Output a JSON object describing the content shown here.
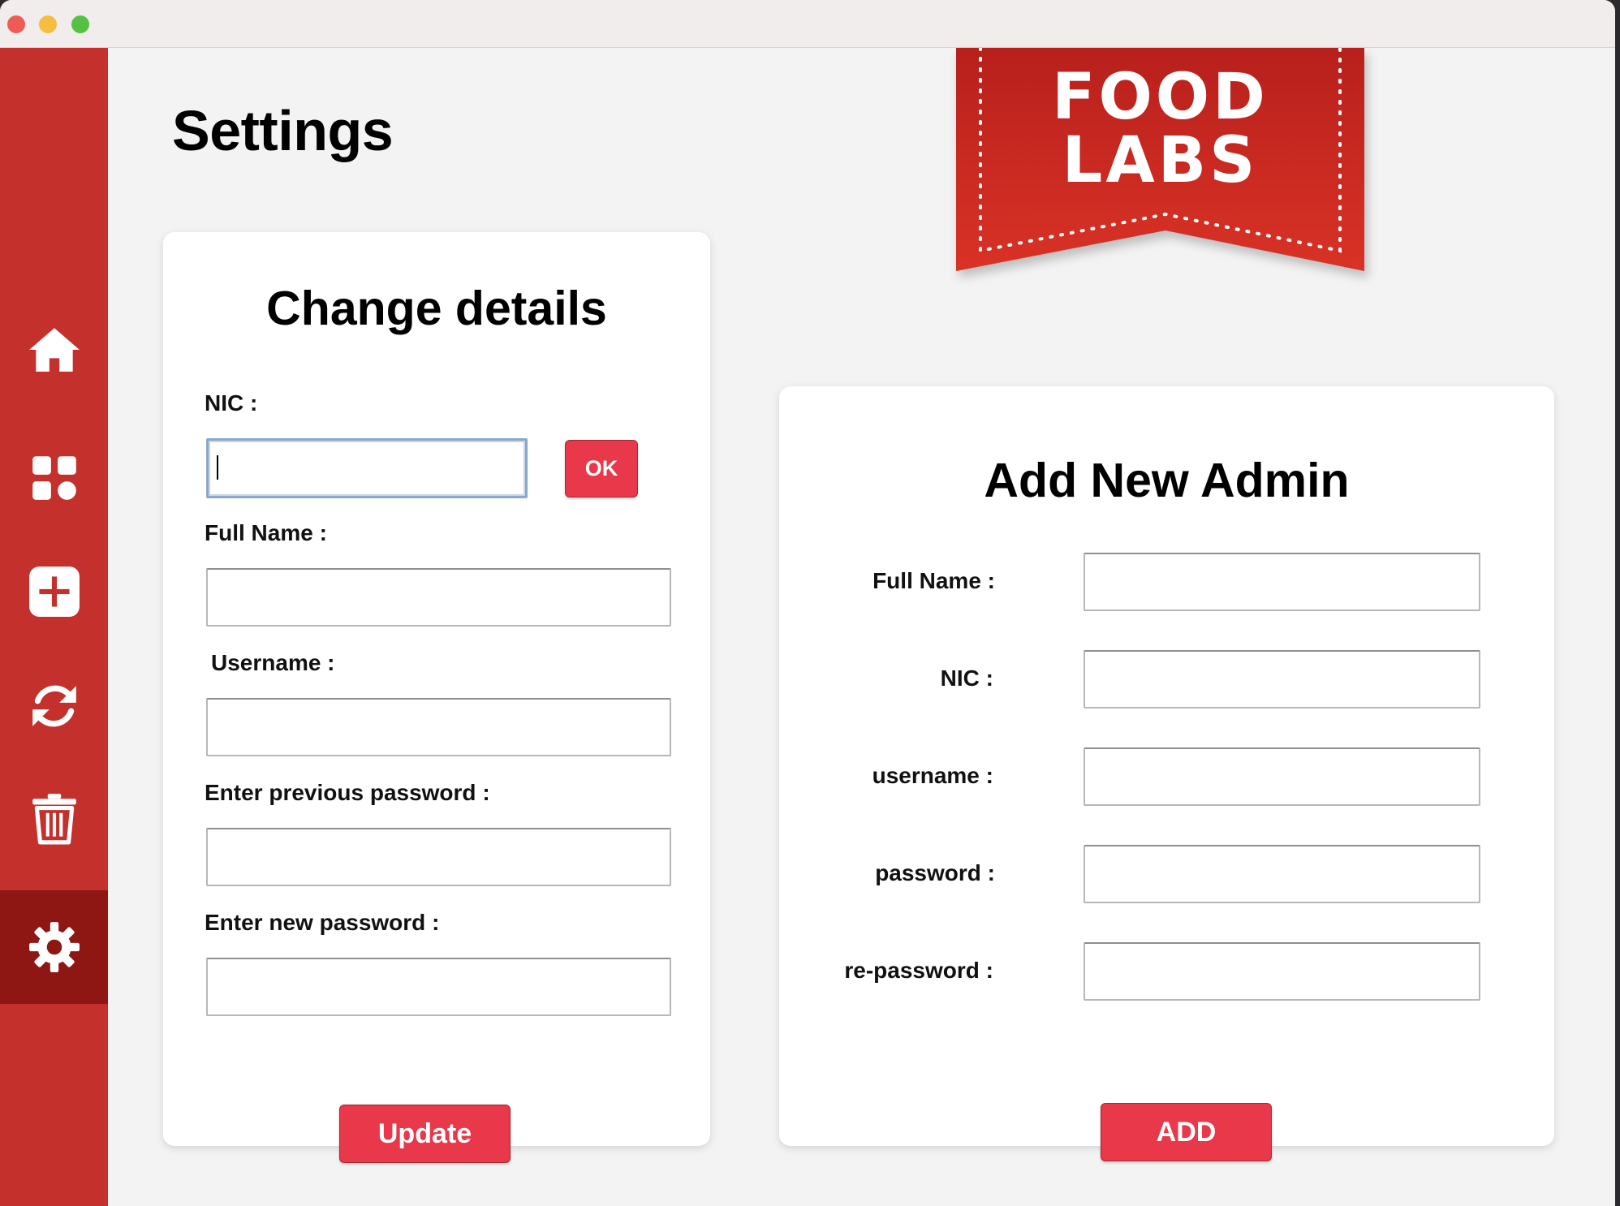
{
  "app": {
    "colors": {
      "sidebar": "#c4302b",
      "sidebar_active": "#8f1713",
      "accent": "#e8384a",
      "background": "#f3f3f3",
      "logo": "#c9302a"
    }
  },
  "sidebar": {
    "items": [
      {
        "icon": "home-icon",
        "active": false
      },
      {
        "icon": "dashboard-icon",
        "active": false
      },
      {
        "icon": "add-icon",
        "active": false
      },
      {
        "icon": "refresh-icon",
        "active": false
      },
      {
        "icon": "trash-icon",
        "active": false
      },
      {
        "icon": "gear-icon",
        "active": true
      }
    ]
  },
  "page": {
    "title": "Settings"
  },
  "logo": {
    "line1": "FOOD",
    "line2": "LABS"
  },
  "change_details": {
    "title": "Change details",
    "nic_label": "NIC :",
    "nic_value": "",
    "ok_label": "OK",
    "full_name_label": "Full Name :",
    "full_name_value": "",
    "username_label": "Username :",
    "username_value": "",
    "prev_password_label": "Enter previous password :",
    "prev_password_value": "",
    "new_password_label": "Enter new password :",
    "new_password_value": "",
    "update_label": "Update"
  },
  "add_admin": {
    "title": "Add New Admin",
    "full_name_label": "Full Name :",
    "full_name_value": "",
    "nic_label": "NIC :",
    "nic_value": "",
    "username_label": "username :",
    "username_value": "",
    "password_label": "password :",
    "password_value": "",
    "repassword_label": "re-password :",
    "repassword_value": "",
    "add_label": "ADD"
  }
}
